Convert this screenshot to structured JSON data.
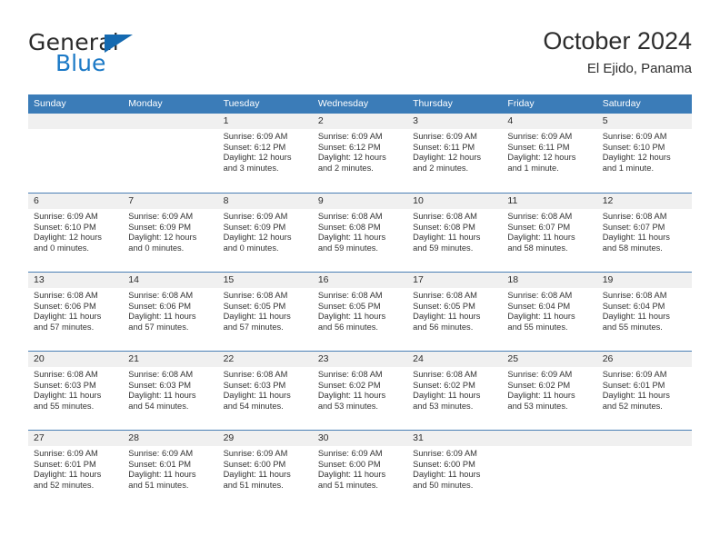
{
  "brand": {
    "word_one": "General",
    "word_two": "Blue",
    "triangle_color": "#1469b0"
  },
  "header": {
    "title": "October 2024",
    "subtitle": "El Ejido, Panama"
  },
  "theme": {
    "header_blue": "#3b7cb8",
    "row_line_blue": "#4a7fb5",
    "day_band_gray": "#f0f0f0",
    "brand_blue": "#1b79c6"
  },
  "weekdays": [
    "Sunday",
    "Monday",
    "Tuesday",
    "Wednesday",
    "Thursday",
    "Friday",
    "Saturday"
  ],
  "weeks": [
    [
      {
        "day": "",
        "sunrise": "",
        "sunset": "",
        "daylight_line1": "",
        "daylight_line2": "",
        "empty": true
      },
      {
        "day": "",
        "sunrise": "",
        "sunset": "",
        "daylight_line1": "",
        "daylight_line2": "",
        "empty": true
      },
      {
        "day": "1",
        "sunrise": "Sunrise: 6:09 AM",
        "sunset": "Sunset: 6:12 PM",
        "daylight_line1": "Daylight: 12 hours",
        "daylight_line2": "and 3 minutes.",
        "empty": false
      },
      {
        "day": "2",
        "sunrise": "Sunrise: 6:09 AM",
        "sunset": "Sunset: 6:12 PM",
        "daylight_line1": "Daylight: 12 hours",
        "daylight_line2": "and 2 minutes.",
        "empty": false
      },
      {
        "day": "3",
        "sunrise": "Sunrise: 6:09 AM",
        "sunset": "Sunset: 6:11 PM",
        "daylight_line1": "Daylight: 12 hours",
        "daylight_line2": "and 2 minutes.",
        "empty": false
      },
      {
        "day": "4",
        "sunrise": "Sunrise: 6:09 AM",
        "sunset": "Sunset: 6:11 PM",
        "daylight_line1": "Daylight: 12 hours",
        "daylight_line2": "and 1 minute.",
        "empty": false
      },
      {
        "day": "5",
        "sunrise": "Sunrise: 6:09 AM",
        "sunset": "Sunset: 6:10 PM",
        "daylight_line1": "Daylight: 12 hours",
        "daylight_line2": "and 1 minute.",
        "empty": false
      }
    ],
    [
      {
        "day": "6",
        "sunrise": "Sunrise: 6:09 AM",
        "sunset": "Sunset: 6:10 PM",
        "daylight_line1": "Daylight: 12 hours",
        "daylight_line2": "and 0 minutes.",
        "empty": false
      },
      {
        "day": "7",
        "sunrise": "Sunrise: 6:09 AM",
        "sunset": "Sunset: 6:09 PM",
        "daylight_line1": "Daylight: 12 hours",
        "daylight_line2": "and 0 minutes.",
        "empty": false
      },
      {
        "day": "8",
        "sunrise": "Sunrise: 6:09 AM",
        "sunset": "Sunset: 6:09 PM",
        "daylight_line1": "Daylight: 12 hours",
        "daylight_line2": "and 0 minutes.",
        "empty": false
      },
      {
        "day": "9",
        "sunrise": "Sunrise: 6:08 AM",
        "sunset": "Sunset: 6:08 PM",
        "daylight_line1": "Daylight: 11 hours",
        "daylight_line2": "and 59 minutes.",
        "empty": false
      },
      {
        "day": "10",
        "sunrise": "Sunrise: 6:08 AM",
        "sunset": "Sunset: 6:08 PM",
        "daylight_line1": "Daylight: 11 hours",
        "daylight_line2": "and 59 minutes.",
        "empty": false
      },
      {
        "day": "11",
        "sunrise": "Sunrise: 6:08 AM",
        "sunset": "Sunset: 6:07 PM",
        "daylight_line1": "Daylight: 11 hours",
        "daylight_line2": "and 58 minutes.",
        "empty": false
      },
      {
        "day": "12",
        "sunrise": "Sunrise: 6:08 AM",
        "sunset": "Sunset: 6:07 PM",
        "daylight_line1": "Daylight: 11 hours",
        "daylight_line2": "and 58 minutes.",
        "empty": false
      }
    ],
    [
      {
        "day": "13",
        "sunrise": "Sunrise: 6:08 AM",
        "sunset": "Sunset: 6:06 PM",
        "daylight_line1": "Daylight: 11 hours",
        "daylight_line2": "and 57 minutes.",
        "empty": false
      },
      {
        "day": "14",
        "sunrise": "Sunrise: 6:08 AM",
        "sunset": "Sunset: 6:06 PM",
        "daylight_line1": "Daylight: 11 hours",
        "daylight_line2": "and 57 minutes.",
        "empty": false
      },
      {
        "day": "15",
        "sunrise": "Sunrise: 6:08 AM",
        "sunset": "Sunset: 6:05 PM",
        "daylight_line1": "Daylight: 11 hours",
        "daylight_line2": "and 57 minutes.",
        "empty": false
      },
      {
        "day": "16",
        "sunrise": "Sunrise: 6:08 AM",
        "sunset": "Sunset: 6:05 PM",
        "daylight_line1": "Daylight: 11 hours",
        "daylight_line2": "and 56 minutes.",
        "empty": false
      },
      {
        "day": "17",
        "sunrise": "Sunrise: 6:08 AM",
        "sunset": "Sunset: 6:05 PM",
        "daylight_line1": "Daylight: 11 hours",
        "daylight_line2": "and 56 minutes.",
        "empty": false
      },
      {
        "day": "18",
        "sunrise": "Sunrise: 6:08 AM",
        "sunset": "Sunset: 6:04 PM",
        "daylight_line1": "Daylight: 11 hours",
        "daylight_line2": "and 55 minutes.",
        "empty": false
      },
      {
        "day": "19",
        "sunrise": "Sunrise: 6:08 AM",
        "sunset": "Sunset: 6:04 PM",
        "daylight_line1": "Daylight: 11 hours",
        "daylight_line2": "and 55 minutes.",
        "empty": false
      }
    ],
    [
      {
        "day": "20",
        "sunrise": "Sunrise: 6:08 AM",
        "sunset": "Sunset: 6:03 PM",
        "daylight_line1": "Daylight: 11 hours",
        "daylight_line2": "and 55 minutes.",
        "empty": false
      },
      {
        "day": "21",
        "sunrise": "Sunrise: 6:08 AM",
        "sunset": "Sunset: 6:03 PM",
        "daylight_line1": "Daylight: 11 hours",
        "daylight_line2": "and 54 minutes.",
        "empty": false
      },
      {
        "day": "22",
        "sunrise": "Sunrise: 6:08 AM",
        "sunset": "Sunset: 6:03 PM",
        "daylight_line1": "Daylight: 11 hours",
        "daylight_line2": "and 54 minutes.",
        "empty": false
      },
      {
        "day": "23",
        "sunrise": "Sunrise: 6:08 AM",
        "sunset": "Sunset: 6:02 PM",
        "daylight_line1": "Daylight: 11 hours",
        "daylight_line2": "and 53 minutes.",
        "empty": false
      },
      {
        "day": "24",
        "sunrise": "Sunrise: 6:08 AM",
        "sunset": "Sunset: 6:02 PM",
        "daylight_line1": "Daylight: 11 hours",
        "daylight_line2": "and 53 minutes.",
        "empty": false
      },
      {
        "day": "25",
        "sunrise": "Sunrise: 6:09 AM",
        "sunset": "Sunset: 6:02 PM",
        "daylight_line1": "Daylight: 11 hours",
        "daylight_line2": "and 53 minutes.",
        "empty": false
      },
      {
        "day": "26",
        "sunrise": "Sunrise: 6:09 AM",
        "sunset": "Sunset: 6:01 PM",
        "daylight_line1": "Daylight: 11 hours",
        "daylight_line2": "and 52 minutes.",
        "empty": false
      }
    ],
    [
      {
        "day": "27",
        "sunrise": "Sunrise: 6:09 AM",
        "sunset": "Sunset: 6:01 PM",
        "daylight_line1": "Daylight: 11 hours",
        "daylight_line2": "and 52 minutes.",
        "empty": false
      },
      {
        "day": "28",
        "sunrise": "Sunrise: 6:09 AM",
        "sunset": "Sunset: 6:01 PM",
        "daylight_line1": "Daylight: 11 hours",
        "daylight_line2": "and 51 minutes.",
        "empty": false
      },
      {
        "day": "29",
        "sunrise": "Sunrise: 6:09 AM",
        "sunset": "Sunset: 6:00 PM",
        "daylight_line1": "Daylight: 11 hours",
        "daylight_line2": "and 51 minutes.",
        "empty": false
      },
      {
        "day": "30",
        "sunrise": "Sunrise: 6:09 AM",
        "sunset": "Sunset: 6:00 PM",
        "daylight_line1": "Daylight: 11 hours",
        "daylight_line2": "and 51 minutes.",
        "empty": false
      },
      {
        "day": "31",
        "sunrise": "Sunrise: 6:09 AM",
        "sunset": "Sunset: 6:00 PM",
        "daylight_line1": "Daylight: 11 hours",
        "daylight_line2": "and 50 minutes.",
        "empty": false
      },
      {
        "day": "",
        "sunrise": "",
        "sunset": "",
        "daylight_line1": "",
        "daylight_line2": "",
        "empty": true
      },
      {
        "day": "",
        "sunrise": "",
        "sunset": "",
        "daylight_line1": "",
        "daylight_line2": "",
        "empty": true
      }
    ]
  ]
}
